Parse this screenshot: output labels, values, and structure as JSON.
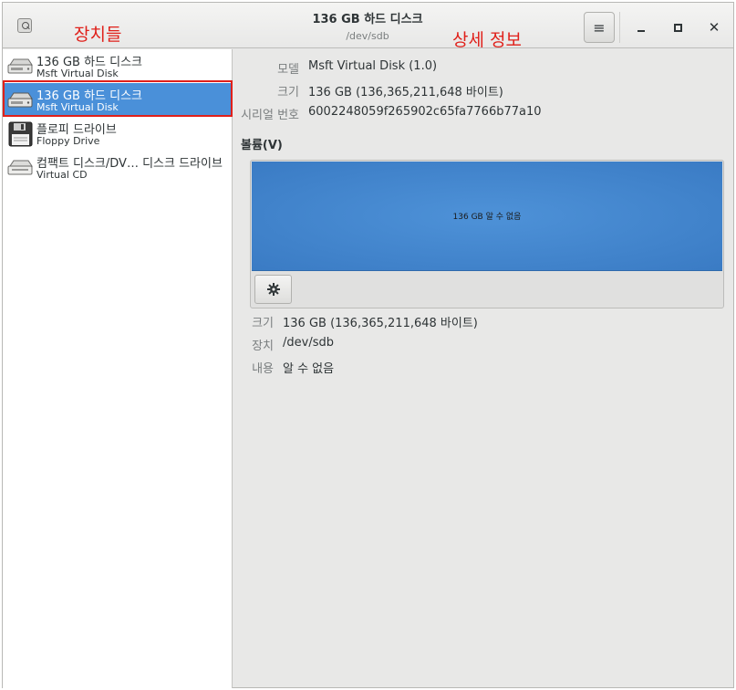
{
  "window": {
    "title": "136 GB 하드 디스크",
    "subtitle": "/dev/sdb"
  },
  "annotations": {
    "devices": "장치들",
    "details": "상세 정보"
  },
  "headerbar": {
    "menu_glyph": "≡",
    "close_glyph": "✕"
  },
  "sidebar": {
    "items": [
      {
        "name": "136 GB 하드 디스크",
        "sub": "Msft Virtual Disk",
        "icon": "hard-disk-icon",
        "selected": false
      },
      {
        "name": "136 GB 하드 디스크",
        "sub": "Msft Virtual Disk",
        "icon": "hard-disk-icon",
        "selected": true
      },
      {
        "name": "플로피 드라이브",
        "sub": "Floppy Drive",
        "icon": "floppy-icon",
        "selected": false
      },
      {
        "name": "컴팩트 디스크/DV… 디스크 드라이브",
        "sub": "Virtual CD",
        "icon": "optical-drive-icon",
        "selected": false
      }
    ]
  },
  "details": {
    "model_label": "모델",
    "model_value": "Msft Virtual Disk (1.0)",
    "size_label": "크기",
    "size_value": "136 GB (136,365,211,648 바이트)",
    "serial_label": "시리얼 번호",
    "serial_value": "6002248059f265902c65fa7766b77a10",
    "volumes_title": "볼륨(V)",
    "volume_bar_label": "136 GB 알 수 없음",
    "volume_size_label": "크기",
    "volume_size_value": "136 GB (136,365,211,648 바이트)",
    "volume_device_label": "장치",
    "volume_device_value": "/dev/sdb",
    "volume_contents_label": "내용",
    "volume_contents_value": "알 수 없음"
  },
  "colors": {
    "selection": "#4a90d9",
    "volume_bar": "#3a7bc4",
    "annotation": "#e0201a"
  }
}
